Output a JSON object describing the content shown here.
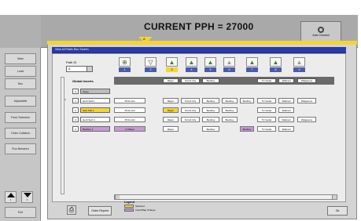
{
  "header": {
    "pph_text": "CURRENT PPH = 27000",
    "auto_button_label": "Auto Connect"
  },
  "sidebar": {
    "items": [
      {
        "label": "Main"
      },
      {
        "label": "Load"
      },
      {
        "label": "Run"
      },
      {
        "label": "Adjustable"
      },
      {
        "label": "Feed Selection"
      },
      {
        "label": "Order Collation"
      },
      {
        "label": "Run Between"
      }
    ],
    "scroll_up_num": "1",
    "scroll_down_num": "2",
    "exit_label": "Exit"
  },
  "panel": {
    "tab_marker": "A",
    "title": "View All Paths  Run  Screen",
    "pathid_label": "Path ID",
    "pathid_value": "A"
  },
  "path_icons": [
    {
      "num": "1",
      "glyph": "⊕",
      "color": "#2d7a2d"
    },
    {
      "num": "2",
      "glyph": "▽",
      "color": "#444444"
    },
    {
      "num": "3",
      "glyph": "▲",
      "color": "#2d8a2d",
      "selected": true
    },
    {
      "num": "4",
      "glyph": "▲",
      "color": "#2d8a2d"
    },
    {
      "num": "5",
      "glyph": "▲",
      "color": "#2d8a2d"
    },
    {
      "num": "6",
      "glyph": "▲",
      "color": "#999999"
    },
    {
      "num": "7",
      "glyph": "▲",
      "color": "#2d8a2d"
    },
    {
      "num": "8",
      "glyph": "▲",
      "color": "#2d8a2d"
    },
    {
      "num": "9",
      "glyph": "▲",
      "color": "#999999"
    }
  ],
  "grid": {
    "left_header": "Global Inserts",
    "header_cells": [
      "Mayer",
      "Circuit City",
      "Bestbuy",
      "TV Guide",
      "Walmart",
      "Walgreens"
    ],
    "rows": [
      {
        "flag": "",
        "idx": "A",
        "name": "Setup",
        "name_bg": "#bcbcbc",
        "cells": []
      },
      {
        "flag": "A",
        "idx": "1",
        "name": "Herb Sect1",
        "cells": [
          "Pizza Hut",
          "Mayer",
          "Circuit City",
          "Bestbuy",
          "Bestbuy",
          "Bestbuy",
          "TV Guide",
          "Walmart",
          "Walgreens"
        ]
      },
      {
        "flag": "",
        "idx": "2",
        "name": "Sect Sub 1",
        "name_bg": "#f3d43b",
        "cells": [
          "Pizza Hut",
          "Mayer",
          "Circuit City",
          "Bestbuy",
          "Bestbuy",
          "TV Guide",
          "Walmart"
        ]
      },
      {
        "flag": "",
        "idx": "3",
        "name": "Herb Sect 1",
        "cells": [
          "Pizza Hut",
          "Mayer",
          "Circuit City",
          "Bestbuy",
          "Bestbuy",
          "TV Guide",
          "Walmart",
          "Walgreens"
        ]
      },
      {
        "flag": "",
        "idx": "4",
        "name": "Bestbuy 1",
        "name_bg": "#c59bd0",
        "cells": [
          "Lt Mayer",
          "Mayer",
          "Bestbuy",
          "Bestbuy",
          "TV Guide",
          "Walmart"
        ]
      }
    ]
  },
  "footer": {
    "order_button": "Order Reprint",
    "legend_title": "Legend",
    "legend_items": [
      {
        "label": "Selected",
        "color": "#f3d43b"
      },
      {
        "label": "Insert/Map Change",
        "color": "#c59bd0"
      }
    ],
    "ok_button": "Ok"
  }
}
